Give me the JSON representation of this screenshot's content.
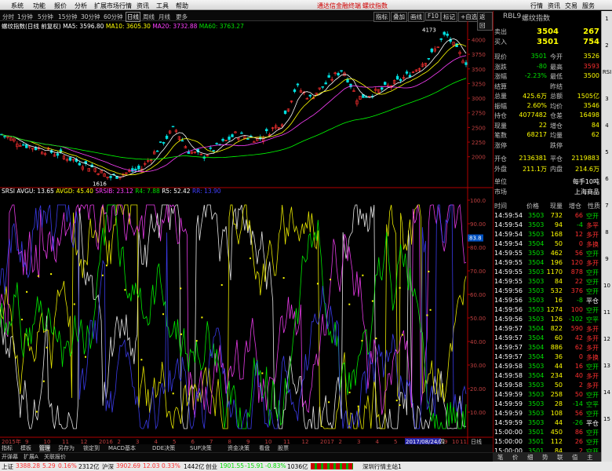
{
  "menu": {
    "items": [
      "系统",
      "功能",
      "报价",
      "分析",
      "扩展市场行情",
      "资讯",
      "工具",
      "帮助"
    ],
    "center": "通达信金融终端",
    "center2": "螺纹指数",
    "right": [
      "行情",
      "资讯",
      "交易",
      "服务"
    ]
  },
  "toolbar": {
    "periods": [
      "分时",
      "1分钟",
      "5分钟",
      "15分钟",
      "30分钟",
      "60分钟",
      "日线",
      "周线",
      "月线",
      "更多"
    ],
    "active": "日线",
    "right": [
      "指标",
      "叠加",
      "画线",
      "F10",
      "标记",
      "+自选",
      "返回"
    ]
  },
  "ma": {
    "title": "螺纹指数(日线 前复权)",
    "ma5": "MA5: 3596.80",
    "ma10": "MA10: 3605.30",
    "ma20": "MA20: 3732.88",
    "ma60": "MA60: 3763.27"
  },
  "rsi": {
    "title": "SRSI AVGU: 13.65",
    "avgd": "AVGD: 45.40",
    "srsib": "SRSIB: 23.12",
    "r4": "R4: 7.88",
    "r5": "R5: 52.42",
    "rr": "RR: 13.90"
  },
  "price_axis": [
    "4000",
    "3750",
    "3500",
    "3250",
    "3000",
    "2750",
    "2500",
    "2250",
    "2000"
  ],
  "rsi_axis": [
    "100.0",
    "90.00",
    "80.00",
    "70.00",
    "60.00",
    "50.00",
    "40.00",
    "30.00",
    "20.00",
    "10.00"
  ],
  "markers": {
    "high": "4173",
    "low": "1616",
    "cur": "83.8"
  },
  "dates": {
    "left": "2015年",
    "items": [
      "9",
      "10",
      "11",
      "12",
      "2016",
      "2",
      "3",
      "4",
      "5",
      "6",
      "7",
      "8",
      "9",
      "10",
      "11",
      "12",
      "2017",
      "2",
      "3",
      "4",
      "5",
      "6",
      "7"
    ],
    "selected": "2017/08/24/四",
    "right1": "9",
    "right2": "10",
    "right3": "11",
    "right4": "日线"
  },
  "bottom_tabs": [
    "指标",
    "模板",
    "管理",
    "另存为",
    "锁定到",
    "MACD基本",
    "DDE决策",
    "SUP决策",
    "资金决策",
    "看盘",
    "股票"
  ],
  "bottom2": [
    "开弹幕",
    "扩展A",
    "关联报价"
  ],
  "status": {
    "sh": "上证",
    "sh_val": "3388.28",
    "sh_chg": "5.29",
    "sh_pct": "0.16%",
    "sh_amt": "2312亿",
    "hs": "沪深",
    "hs_val": "3902.69",
    "hs_chg": "12.03",
    "hs_pct": "0.33%",
    "hs_amt": "1442亿",
    "cy": "创业",
    "cy_val": "1901.55",
    "cy_chg": "-15.91",
    "cy_pct": "-0.83%",
    "cy_amt": "1036亿",
    "station": "深圳行情主站1"
  },
  "panel": {
    "code": "RBL9",
    "name": "螺纹指数",
    "ask_lbl": "卖出",
    "ask": "3504",
    "ask_v": "267",
    "bid_lbl": "买入",
    "bid": "3501",
    "bid_v": "754",
    "rows": [
      [
        "现价",
        "3501",
        "今开",
        "3526"
      ],
      [
        "涨跌",
        "-80",
        "最高",
        "3593"
      ],
      [
        "涨幅",
        "-2.23%",
        "最低",
        "3500"
      ],
      [
        "结算",
        "",
        "昨结",
        ""
      ],
      [
        "总量",
        "425.6万",
        "总额",
        "1505亿"
      ],
      [
        "振幅",
        "2.60%",
        "均价",
        "3546"
      ]
    ],
    "rows2": [
      [
        "持仓",
        "4077482",
        "仓差",
        "16498"
      ],
      [
        "现量",
        "22",
        "增仓",
        "84"
      ],
      [
        "笔数",
        "68217",
        "均量",
        "62"
      ],
      [
        "涨停",
        "",
        "跌停",
        ""
      ]
    ],
    "rows3": [
      [
        "开仓",
        "2136381",
        "平仓",
        "2119883"
      ],
      [
        "外盘",
        "211.1万",
        "内盘",
        "214.6万"
      ]
    ],
    "unit_lbl": "单位",
    "unit": "每手10吨",
    "mkt_lbl": "市场",
    "mkt": "上海商品",
    "tick_head": [
      "时间",
      "价格",
      "现量",
      "增仓",
      "性质"
    ],
    "ticks": [
      [
        "14:59:54",
        "3503",
        "732",
        "66",
        "空开"
      ],
      [
        "14:59:54",
        "3503",
        "94",
        "-4",
        "多平"
      ],
      [
        "14:59:54",
        "3503",
        "168",
        "12",
        "多开"
      ],
      [
        "14:59:54",
        "3504",
        "50",
        "0",
        "多换"
      ],
      [
        "14:59:55",
        "3503",
        "462",
        "56",
        "空开"
      ],
      [
        "14:59:55",
        "3504",
        "196",
        "120",
        "多开"
      ],
      [
        "14:59:55",
        "3503",
        "1170",
        "878",
        "空开"
      ],
      [
        "14:59:55",
        "3503",
        "84",
        "22",
        "空开"
      ],
      [
        "14:59:56",
        "3503",
        "532",
        "376",
        "空开"
      ],
      [
        "14:59:56",
        "3503",
        "16",
        "-8",
        "平仓"
      ],
      [
        "14:59:56",
        "3503",
        "1274",
        "100",
        "空开"
      ],
      [
        "14:59:56",
        "3503",
        "126",
        "-102",
        "空平"
      ],
      [
        "14:59:57",
        "3504",
        "822",
        "590",
        "多开"
      ],
      [
        "14:59:57",
        "3504",
        "60",
        "42",
        "多开"
      ],
      [
        "14:59:57",
        "3504",
        "886",
        "62",
        "多开"
      ],
      [
        "14:59:57",
        "3504",
        "36",
        "0",
        "多换"
      ],
      [
        "14:59:58",
        "3503",
        "44",
        "16",
        "空开"
      ],
      [
        "14:59:58",
        "3504",
        "234",
        "40",
        "多开"
      ],
      [
        "14:59:58",
        "3503",
        "50",
        "2",
        "多开"
      ],
      [
        "14:59:59",
        "3503",
        "258",
        "50",
        "空开"
      ],
      [
        "14:59:59",
        "3503",
        "28",
        "-14",
        "空平"
      ],
      [
        "14:59:59",
        "3503",
        "108",
        "56",
        "空开"
      ],
      [
        "14:59:59",
        "3503",
        "44",
        "-26",
        "平仓"
      ],
      [
        "15:00:00",
        "3501",
        "450",
        "86",
        "空开"
      ],
      [
        "15:00:00",
        "3501",
        "112",
        "26",
        "空开"
      ],
      [
        "15:00:00",
        "3501",
        "84",
        "2",
        "空开"
      ]
    ],
    "tabs": [
      "笔",
      "价",
      "细",
      "势",
      "联",
      "值",
      "主"
    ]
  },
  "sidestrip": [
    "1",
    "2",
    "RSI",
    "3",
    "4",
    "5",
    "6",
    "7",
    "8",
    "9",
    "10",
    "11",
    "12",
    "13",
    "14",
    "15"
  ],
  "colors": {
    "up": "#ff3030",
    "down": "#00e000",
    "ma5": "#ffffff",
    "ma10": "#ffff00",
    "ma20": "#ff40ff",
    "ma60": "#00ff00",
    "axis": "#b00000"
  }
}
